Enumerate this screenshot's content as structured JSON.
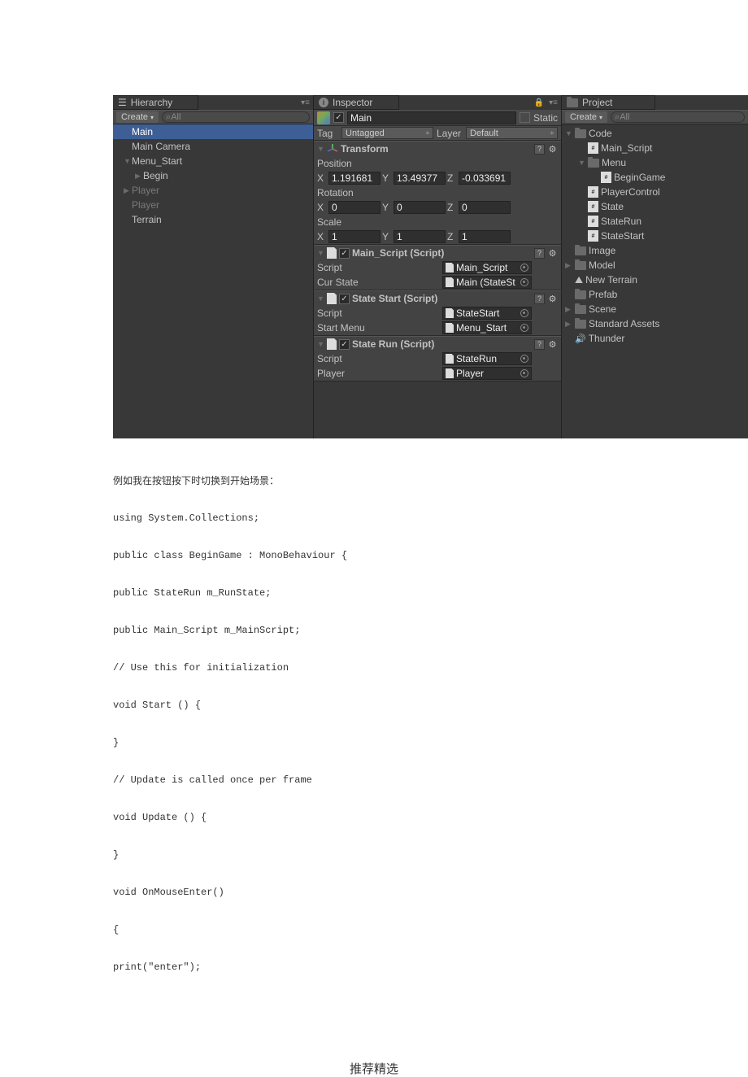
{
  "hierarchy": {
    "tab": "Hierarchy",
    "create": "Create",
    "search": "All",
    "items": [
      {
        "label": "Main",
        "sel": true
      },
      {
        "label": "Main Camera"
      },
      {
        "label": "Menu_Start",
        "arrow": "down"
      },
      {
        "label": "Begin",
        "indent": 1,
        "arrow": "right"
      },
      {
        "label": "Player",
        "arrow": "right",
        "dim": true
      },
      {
        "label": "Player",
        "dim": true
      },
      {
        "label": "Terrain"
      }
    ]
  },
  "inspector": {
    "tab": "Inspector",
    "name": "Main",
    "static": "Static",
    "tag_label": "Tag",
    "tag": "Untagged",
    "layer_label": "Layer",
    "layer": "Default",
    "transform": {
      "title": "Transform",
      "pos_label": "Position",
      "pos": {
        "x": "1.191681",
        "y": "13.49377",
        "z": "-0.033691"
      },
      "rot_label": "Rotation",
      "rot": {
        "x": "0",
        "y": "0",
        "z": "0"
      },
      "scl_label": "Scale",
      "scl": {
        "x": "1",
        "y": "1",
        "z": "1"
      }
    },
    "components": [
      {
        "title": "Main_Script (Script)",
        "rows": [
          {
            "label": "Script",
            "val": "Main_Script",
            "obj": true
          },
          {
            "label": "Cur State",
            "val": "Main (StateSt",
            "obj": true
          }
        ]
      },
      {
        "title": "State Start (Script)",
        "rows": [
          {
            "label": "Script",
            "val": "StateStart",
            "obj": true
          },
          {
            "label": "Start Menu",
            "val": "Menu_Start",
            "obj": true
          }
        ]
      },
      {
        "title": "State Run (Script)",
        "rows": [
          {
            "label": "Script",
            "val": "StateRun",
            "obj": true
          },
          {
            "label": "Player",
            "val": "Player",
            "obj": true
          }
        ]
      }
    ]
  },
  "project": {
    "tab": "Project",
    "create": "Create",
    "search": "All",
    "tree": [
      {
        "label": "Code",
        "type": "folder",
        "depth": 0,
        "arrow": "down"
      },
      {
        "label": "Main_Script",
        "type": "cs",
        "depth": 1
      },
      {
        "label": "Menu",
        "type": "folder",
        "depth": 1,
        "arrow": "down"
      },
      {
        "label": "BeginGame",
        "type": "cs",
        "depth": 2
      },
      {
        "label": "PlayerControl",
        "type": "cs",
        "depth": 1
      },
      {
        "label": "State",
        "type": "cs",
        "depth": 1
      },
      {
        "label": "StateRun",
        "type": "cs",
        "depth": 1
      },
      {
        "label": "StateStart",
        "type": "cs",
        "depth": 1
      },
      {
        "label": "Image",
        "type": "folder",
        "depth": 0
      },
      {
        "label": "Model",
        "type": "folder",
        "depth": 0,
        "arrow": "right"
      },
      {
        "label": "New Terrain",
        "type": "terrain",
        "depth": 0
      },
      {
        "label": "Prefab",
        "type": "folder",
        "depth": 0
      },
      {
        "label": "Scene",
        "type": "folder",
        "depth": 0,
        "arrow": "right"
      },
      {
        "label": "Standard Assets",
        "type": "folder",
        "depth": 0,
        "arrow": "right"
      },
      {
        "label": "Thunder",
        "type": "audio",
        "depth": 0
      }
    ]
  },
  "article": {
    "lines": [
      "例如我在按钮按下时切换到开始场景：",
      "using System.Collections;",
      "public class BeginGame : MonoBehaviour {",
      "public StateRun m_RunState;",
      "public Main_Script m_MainScript;",
      "// Use this for initialization",
      "void Start () {",
      "}",
      "// Update is called once per frame",
      "void Update () {",
      "}",
      "void OnMouseEnter()",
      "{",
      "print(\"enter\");"
    ],
    "footer": "推荐精选"
  }
}
